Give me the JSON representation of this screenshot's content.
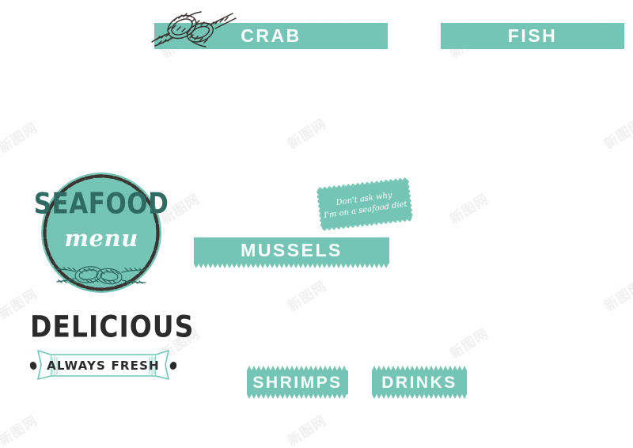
{
  "page": {
    "background_color": "#ffffff",
    "accent_color": "#74c5b5",
    "accent_dark_color": "#2f6b62",
    "ink_color": "#2b2b2b"
  },
  "badge": {
    "title": "SEAFOOD",
    "subtitle": "menu",
    "knot_icon": "rope-knot-icon"
  },
  "tagline": {
    "word": "DELICIOUS",
    "ribbon_text": "ALWAYS FRESH"
  },
  "quote_tag": {
    "line1": "Don't ask why",
    "line2": "I'm on a seafood diet"
  },
  "banners": [
    {
      "id": "crab",
      "label": "CRAB",
      "style": "brush",
      "font_size": 23
    },
    {
      "id": "fish",
      "label": "FISH",
      "style": "brush",
      "font_size": 23
    },
    {
      "id": "mussels",
      "label": "MUSSELS",
      "style": "zigzag",
      "font_size": 23
    },
    {
      "id": "shrimps",
      "label": "SHRIMPS",
      "style": "zigzag",
      "font_size": 21
    },
    {
      "id": "drinks",
      "label": "DRINKS",
      "style": "zigzag",
      "font_size": 21
    }
  ],
  "decorations": {
    "crab_knot_icon": "rope-knot-icon"
  },
  "watermark": {
    "text": "新图网"
  }
}
